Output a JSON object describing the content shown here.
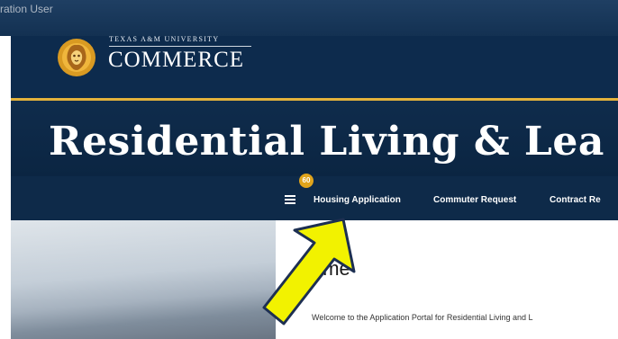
{
  "browser": {
    "user_label": "ration User"
  },
  "logo": {
    "top_line": "TEXAS A&M UNIVERSITY",
    "bottom_line": "COMMERCE"
  },
  "banner": {
    "title": "Residential Living & Lea"
  },
  "nav": {
    "badge_count": "60",
    "items": [
      {
        "label": "Housing Application"
      },
      {
        "label": "Commuter Request"
      },
      {
        "label": "Contract Re"
      }
    ]
  },
  "welcome": {
    "heading": "ome",
    "text": "Welcome to the Application Portal for Residential Living and L"
  },
  "icons": [
    "menu-icon",
    "lion-logo-icon",
    "annotation-arrow-icon"
  ],
  "colors": {
    "navy": "#0d2b4d",
    "gold": "#e3b23c",
    "badge": "#e0a41c",
    "arrow": "#f2f200"
  }
}
